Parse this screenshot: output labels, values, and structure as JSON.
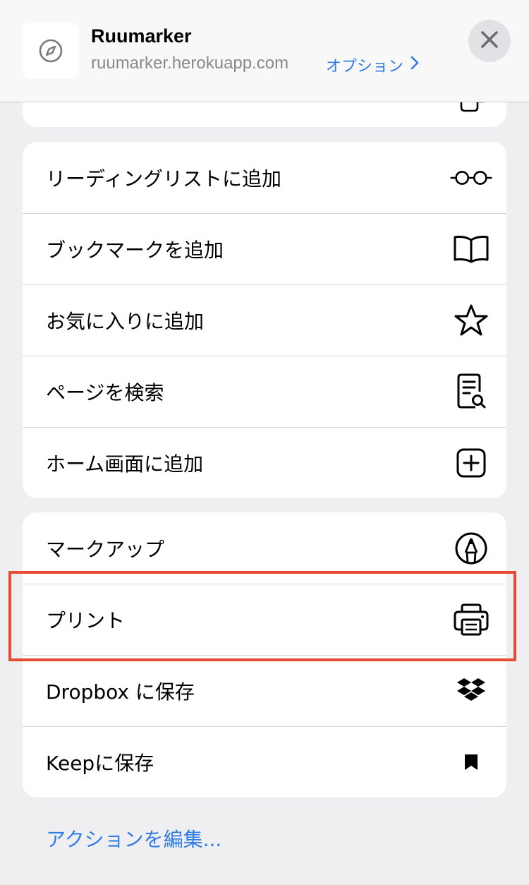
{
  "header": {
    "title": "Ruumarker",
    "url": "ruumarker.herokuapp.com",
    "options_label": "オプション",
    "app_icon": "compass-icon",
    "close_icon": "close-icon"
  },
  "groups": [
    {
      "items": [
        {
          "label": "リーディングリストに追加",
          "icon": "glasses-icon"
        },
        {
          "label": "ブックマークを追加",
          "icon": "book-icon"
        },
        {
          "label": "お気に入りに追加",
          "icon": "star-icon"
        },
        {
          "label": "ページを検索",
          "icon": "find-on-page-icon"
        },
        {
          "label": "ホーム画面に追加",
          "icon": "add-square-icon"
        }
      ]
    },
    {
      "items": [
        {
          "label": "マークアップ",
          "icon": "markup-pen-icon"
        },
        {
          "label": "プリント",
          "icon": "printer-icon"
        },
        {
          "label": "Dropbox に保存",
          "icon": "dropbox-icon"
        },
        {
          "label": "Keepに保存",
          "icon": "bookmark-icon"
        }
      ]
    }
  ],
  "edit_actions_label": "アクションを編集...",
  "colors": {
    "accent": "#2f7ce5",
    "highlight": "#e74a32",
    "background": "#efeff1"
  }
}
